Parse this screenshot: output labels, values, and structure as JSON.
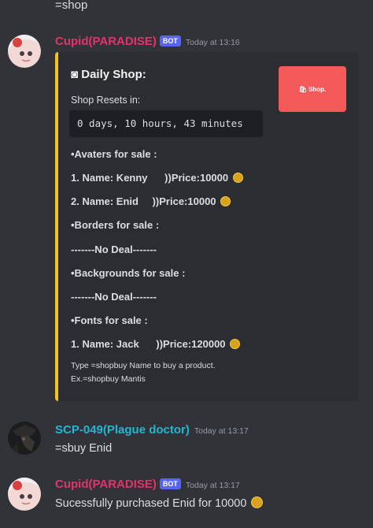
{
  "top_message": "=shop",
  "messages": [
    {
      "author": "Cupid(PARADISE)",
      "bot_tag": "BOT",
      "timestamp": "Today at 13:16",
      "embed": {
        "title_icon": "◙",
        "title": "Daily Shop:",
        "thumbnail_label": "🛍 Shop.",
        "reset_label": "Shop Resets in:",
        "countdown": "0 days, 10 hours, 43 minutes",
        "avatars_header": "•Avaters for sale :",
        "avatar_items": [
          {
            "name": "1. Name: Kenny",
            "price": "))Price:10000"
          },
          {
            "name": "2. Name: Enid",
            "price": "))Price:10000"
          }
        ],
        "borders_header": "•Borders for sale :",
        "borders_value": "-------No Deal-------",
        "backgrounds_header": "•Backgrounds for sale :",
        "backgrounds_value": "-------No Deal-------",
        "fonts_header": "•Fonts for sale :",
        "font_items": [
          {
            "name": "1. Name: Jack",
            "price": "))Price:120000"
          }
        ],
        "footer_line1": "Type =shopbuy Name to buy a product.",
        "footer_line2": "Ex.=shopbuy Mantis",
        "accent_color": "#f0c419"
      }
    },
    {
      "author": "SCP-049(Plague doctor)",
      "timestamp": "Today at 13:17",
      "text": "=sbuy Enid"
    },
    {
      "author": "Cupid(PARADISE)",
      "bot_tag": "BOT",
      "timestamp": "Today at 13:17",
      "text": "Sucessfully purchased Enid for 10000"
    }
  ],
  "colors": {
    "background": "#313338",
    "embed_background": "#2b2d31",
    "cupid_name": "#e2336b",
    "scp_name": "#1fb8cf",
    "bot_tag": "#5865f2"
  },
  "icons": {
    "coin": "coin-icon",
    "title": "square-icon"
  }
}
